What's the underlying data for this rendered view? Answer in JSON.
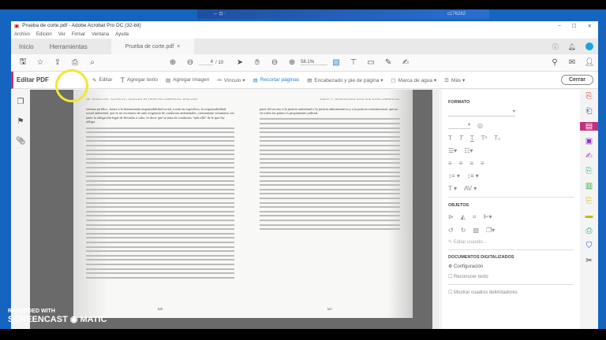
{
  "taskbar": {
    "clock": "c176282"
  },
  "window": {
    "title": "Prueba de corte.pdf - Adobe Acrobat Pro DC (32-bit)",
    "controls": [
      "–",
      "☐",
      "✕"
    ]
  },
  "menu": [
    "Archivo",
    "Edición",
    "Ver",
    "Firmar",
    "Ventana",
    "Ayuda"
  ],
  "tabs": {
    "home": "Inicio",
    "tools": "Herramientas",
    "doc": "Prueba de corte.pdf",
    "close": "×"
  },
  "toolbar": {
    "page_current": "4",
    "page_total": "/ 10",
    "zoom": "58.1%"
  },
  "editbar": {
    "title": "Editar PDF",
    "items": [
      "Editar",
      "Agregar texto",
      "Agregar imagen",
      "Vínculo ▾",
      "Recortar páginas",
      "Encabezado y pie de página ▾",
      "Marca de agua ▾",
      "Más ▾"
    ],
    "close": "Cerrar",
    "accent": "#c0327d"
  },
  "document": {
    "left": {
      "header": "DR. PEDRO POL VALENCIA  |  TRATADO DE DERECHO AMBIENTAL PERUANO",
      "text": "sistema jurídico, frente a la denominada responsabilidad social, o más en específico, la responsabilidad social ambiental, que es un escenario de auto exigencia de conductas ambientales, ciertamente voluntaria, sin tener la obligación legal de llevarlas a cabo, es decir que se trata de conductas \"más allá\" de lo que ley obliga.",
      "page": "620"
    },
    "right": {
      "header": "PARTE V  |  RESPONSABILIDAD POR DAÑO AMBIENTAL",
      "text": "parte del acceso a la justicia ambiental o la justicia administrativa y a la justicia constitucional, que no en todos los países es propiamente judicial.",
      "page": "621"
    }
  },
  "panel": {
    "format": "FORMATO",
    "objects": "OBJETOS",
    "edit_using": "Editar usando...",
    "scanned": "DOCUMENTOS DIGITALIZADOS",
    "config": "Configuración",
    "recognize": "Reconocer texto",
    "show_boxes": "Mostrar cuadros delimitadores"
  },
  "watermark": {
    "line1": "RECORDED WITH",
    "line2": "SCREENCAST",
    "line3": "MATIC"
  }
}
